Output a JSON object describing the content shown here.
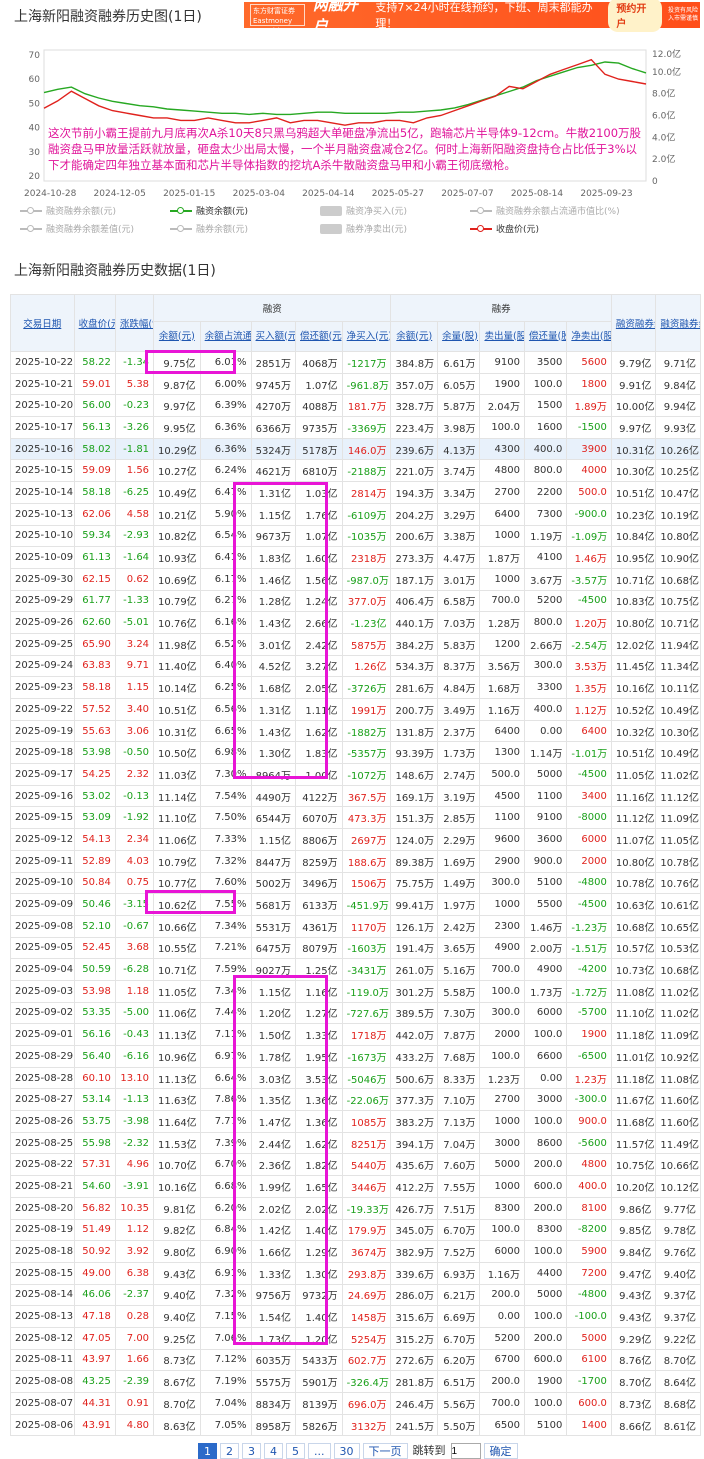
{
  "chart_section": {
    "title": "上海新阳融资融券历史图(1日)"
  },
  "ad": {
    "logo": "东方财富证券",
    "logo_sub": "Eastmoney Securities",
    "headline": "两融开户",
    "text": "支持7×24小时在线预约，下班、周末都能办理！",
    "button": "预约开户",
    "fine": "投资有风险 入市需谨慎"
  },
  "chart_annotation": "这次节前小霸王提前九月底再次A杀10天8只黑乌鸦超大单砸盘净流出5亿，跑输芯片半导体9-12cm。牛散2100万股融资盘马甲放量活跃就放量，砸盘太少出局太慢，一个半月融资盘减仓2亿。何时上海新阳融资盘持仓占比低于3%以下才能确定四年独立基本面和芯片半导体指数的挖坑A杀牛散融资盘马甲和小霸王彻底缴枪。",
  "chart_data": {
    "type": "line",
    "x_ticks": [
      "2024-10-28",
      "2024-12-05",
      "2025-01-15",
      "2025-03-04",
      "2025-04-14",
      "2025-05-27",
      "2025-07-07",
      "2025-08-14",
      "2025-09-23"
    ],
    "y_left_ticks": [
      "70",
      "60",
      "50",
      "40",
      "30",
      "20"
    ],
    "y_left_range": [
      18,
      72
    ],
    "y_right_ticks": [
      "12.0亿",
      "10.0亿",
      "8.0亿",
      "6.0亿",
      "4.0亿",
      "2.0亿",
      "0"
    ],
    "y_right_range": [
      0,
      12
    ],
    "series": [
      {
        "name": "融资余额(元)",
        "axis": "right",
        "color": "#27a822",
        "values": [
          8.1,
          8.4,
          8.6,
          8.0,
          7.6,
          7.3,
          7.1,
          6.9,
          6.8,
          6.6,
          6.5,
          6.4,
          6.3,
          6.2,
          6.2,
          6.1,
          6.2,
          6.1,
          6.1,
          6.2,
          6.3,
          6.3,
          6.2,
          6.2,
          6.2,
          6.2,
          6.3,
          6.3,
          6.4,
          6.5,
          6.7,
          7.0,
          7.4,
          7.8,
          8.2,
          8.6,
          9.2,
          9.6,
          10.0,
          10.4,
          10.6,
          10.9,
          10.8,
          10.3,
          9.9
        ]
      },
      {
        "name": "收盘价(元)",
        "axis": "left",
        "color": "#e0221d",
        "values": [
          48,
          51,
          55,
          52,
          49,
          47,
          46,
          45,
          44,
          44,
          43,
          43,
          44,
          43,
          42,
          42,
          43,
          44,
          42,
          43,
          43,
          42,
          41,
          42,
          42,
          43,
          43,
          42,
          44,
          45,
          47,
          49,
          51,
          53,
          57,
          56,
          59,
          62,
          64,
          66,
          68,
          62,
          60,
          59,
          58
        ]
      }
    ],
    "legend": [
      {
        "label": "融资融券余额(元)",
        "active": false,
        "kind": "line"
      },
      {
        "label": "融资余额(元)",
        "active": true,
        "kind": "line"
      },
      {
        "label": "融资净买入(元)",
        "active": false,
        "kind": "bar"
      },
      {
        "label": "融资融券余额占流通市值比(%)",
        "active": false,
        "kind": "line"
      },
      {
        "label": "融资融券余额差值(元)",
        "active": false,
        "kind": "line"
      },
      {
        "label": "融券余额(元)",
        "active": false,
        "kind": "line"
      },
      {
        "label": "融券净卖出(元)",
        "active": false,
        "kind": "bar"
      },
      {
        "label": "收盘价(元)",
        "active": true,
        "kind": "line"
      }
    ]
  },
  "table_section": {
    "title": "上海新阳融资融券历史数据(1日)"
  },
  "table": {
    "group_rz": "融资",
    "group_rq": "融券",
    "headers": {
      "date": "交易日期",
      "close": "收盘价(元)",
      "chg": "涨跌幅(%)",
      "rz_bal": "余额(元)",
      "rz_ratio": "余额占流通市值比",
      "rz_buy": "买入额(元)",
      "rz_repay": "偿还额(元)",
      "rz_net": "净买入(元)",
      "rq_bal": "余额(元)",
      "rq_vol": "余量(股)",
      "rq_sell": "卖出量(股)",
      "rq_repay": "偿还量(股)",
      "rq_net": "净卖出(股)",
      "total": "融资融券余额(元)",
      "diff": "融资融券余额差值(元)"
    },
    "rows": [
      [
        "2025-10-22",
        "58.22",
        "-1.34",
        "9.75亿",
        "6.01%",
        "2851万",
        "4068万",
        "-1217万",
        "384.8万",
        "6.61万",
        "9100",
        "3500",
        "5600",
        "9.79亿",
        "9.71亿"
      ],
      [
        "2025-10-21",
        "59.01",
        "5.38",
        "9.87亿",
        "6.00%",
        "9745万",
        "1.07亿",
        "-961.8万",
        "357.0万",
        "6.05万",
        "1900",
        "100.0",
        "1800",
        "9.91亿",
        "9.84亿"
      ],
      [
        "2025-10-20",
        "56.00",
        "-0.23",
        "9.97亿",
        "6.39%",
        "4270万",
        "4088万",
        "181.7万",
        "328.7万",
        "5.87万",
        "2.04万",
        "1500",
        "1.89万",
        "10.00亿",
        "9.94亿"
      ],
      [
        "2025-10-17",
        "56.13",
        "-3.26",
        "9.95亿",
        "6.36%",
        "6366万",
        "9735万",
        "-3369万",
        "223.4万",
        "3.98万",
        "100.0",
        "1600",
        "-1500",
        "9.97亿",
        "9.93亿"
      ],
      [
        "2025-10-16",
        "58.02",
        "-1.81",
        "10.29亿",
        "6.36%",
        "5324万",
        "5178万",
        "146.0万",
        "239.6万",
        "4.13万",
        "4300",
        "400.0",
        "3900",
        "10.31亿",
        "10.26亿"
      ],
      [
        "2025-10-15",
        "59.09",
        "1.56",
        "10.27亿",
        "6.24%",
        "4621万",
        "6810万",
        "-2188万",
        "221.0万",
        "3.74万",
        "4800",
        "800.0",
        "4000",
        "10.30亿",
        "10.25亿"
      ],
      [
        "2025-10-14",
        "58.18",
        "-6.25",
        "10.49亿",
        "6.47%",
        "1.31亿",
        "1.03亿",
        "2814万",
        "194.3万",
        "3.34万",
        "2700",
        "2200",
        "500.0",
        "10.51亿",
        "10.47亿"
      ],
      [
        "2025-10-13",
        "62.06",
        "4.58",
        "10.21亿",
        "5.90%",
        "1.15亿",
        "1.76亿",
        "-6109万",
        "204.2万",
        "3.29万",
        "6400",
        "7300",
        "-900.0",
        "10.23亿",
        "10.19亿"
      ],
      [
        "2025-10-10",
        "59.34",
        "-2.93",
        "10.82亿",
        "6.54%",
        "9673万",
        "1.07亿",
        "-1035万",
        "200.6万",
        "3.38万",
        "1000",
        "1.19万",
        "-1.09万",
        "10.84亿",
        "10.80亿"
      ],
      [
        "2025-10-09",
        "61.13",
        "-1.64",
        "10.93亿",
        "6.41%",
        "1.83亿",
        "1.60亿",
        "2318万",
        "273.3万",
        "4.47万",
        "1.87万",
        "4100",
        "1.46万",
        "10.95亿",
        "10.90亿"
      ],
      [
        "2025-09-30",
        "62.15",
        "0.62",
        "10.69亿",
        "6.17%",
        "1.46亿",
        "1.56亿",
        "-987.0万",
        "187.1万",
        "3.01万",
        "1000",
        "3.67万",
        "-3.57万",
        "10.71亿",
        "10.68亿"
      ],
      [
        "2025-09-29",
        "61.77",
        "-1.33",
        "10.79亿",
        "6.27%",
        "1.28亿",
        "1.24亿",
        "377.0万",
        "406.4万",
        "6.58万",
        "700.0",
        "5200",
        "-4500",
        "10.83亿",
        "10.75亿"
      ],
      [
        "2025-09-26",
        "62.60",
        "-5.01",
        "10.76亿",
        "6.16%",
        "1.43亿",
        "2.66亿",
        "-1.23亿",
        "440.1万",
        "7.03万",
        "1.28万",
        "800.0",
        "1.20万",
        "10.80亿",
        "10.71亿"
      ],
      [
        "2025-09-25",
        "65.90",
        "3.24",
        "11.98亿",
        "6.52%",
        "3.01亿",
        "2.42亿",
        "5875万",
        "384.2万",
        "5.83万",
        "1200",
        "2.66万",
        "-2.54万",
        "12.02亿",
        "11.94亿"
      ],
      [
        "2025-09-24",
        "63.83",
        "9.71",
        "11.40亿",
        "6.40%",
        "4.52亿",
        "3.27亿",
        "1.26亿",
        "534.3万",
        "8.37万",
        "3.56万",
        "300.0",
        "3.53万",
        "11.45亿",
        "11.34亿"
      ],
      [
        "2025-09-23",
        "58.18",
        "1.15",
        "10.14亿",
        "6.25%",
        "1.68亿",
        "2.05亿",
        "-3726万",
        "281.6万",
        "4.84万",
        "1.68万",
        "3300",
        "1.35万",
        "10.16亿",
        "10.11亿"
      ],
      [
        "2025-09-22",
        "57.52",
        "3.40",
        "10.51亿",
        "6.56%",
        "1.31亿",
        "1.11亿",
        "1991万",
        "200.7万",
        "3.49万",
        "1.16万",
        "400.0",
        "1.12万",
        "10.52亿",
        "10.49亿"
      ],
      [
        "2025-09-19",
        "55.63",
        "3.06",
        "10.31亿",
        "6.65%",
        "1.43亿",
        "1.62亿",
        "-1882万",
        "131.8万",
        "2.37万",
        "6400",
        "0.00",
        "6400",
        "10.32亿",
        "10.30亿"
      ],
      [
        "2025-09-18",
        "53.98",
        "-0.50",
        "10.50亿",
        "6.98%",
        "1.30亿",
        "1.83亿",
        "-5357万",
        "93.39万",
        "1.73万",
        "1300",
        "1.14万",
        "-1.01万",
        "10.51亿",
        "10.49亿"
      ],
      [
        "2025-09-17",
        "54.25",
        "2.32",
        "11.03亿",
        "7.30%",
        "8964万",
        "1.00亿",
        "-1072万",
        "148.6万",
        "2.74万",
        "500.0",
        "5000",
        "-4500",
        "11.05亿",
        "11.02亿"
      ],
      [
        "2025-09-16",
        "53.02",
        "-0.13",
        "11.14亿",
        "7.54%",
        "4490万",
        "4122万",
        "367.5万",
        "169.1万",
        "3.19万",
        "4500",
        "1100",
        "3400",
        "11.16亿",
        "11.12亿"
      ],
      [
        "2025-09-15",
        "53.09",
        "-1.92",
        "11.10亿",
        "7.50%",
        "6544万",
        "6070万",
        "473.3万",
        "151.3万",
        "2.85万",
        "1100",
        "9100",
        "-8000",
        "11.12亿",
        "11.09亿"
      ],
      [
        "2025-09-12",
        "54.13",
        "2.34",
        "11.06亿",
        "7.33%",
        "1.15亿",
        "8806万",
        "2697万",
        "124.0万",
        "2.29万",
        "9600",
        "3600",
        "6000",
        "11.07亿",
        "11.05亿"
      ],
      [
        "2025-09-11",
        "52.89",
        "4.03",
        "10.79亿",
        "7.32%",
        "8447万",
        "8259万",
        "188.6万",
        "89.38万",
        "1.69万",
        "2900",
        "900.0",
        "2000",
        "10.80亿",
        "10.78亿"
      ],
      [
        "2025-09-10",
        "50.84",
        "0.75",
        "10.77亿",
        "7.60%",
        "5002万",
        "3496万",
        "1506万",
        "75.75万",
        "1.49万",
        "300.0",
        "5100",
        "-4800",
        "10.78亿",
        "10.76亿"
      ],
      [
        "2025-09-09",
        "50.46",
        "-3.15",
        "10.62亿",
        "7.55%",
        "5681万",
        "6133万",
        "-451.9万",
        "99.41万",
        "1.97万",
        "1000",
        "5500",
        "-4500",
        "10.63亿",
        "10.61亿"
      ],
      [
        "2025-09-08",
        "52.10",
        "-0.67",
        "10.66亿",
        "7.34%",
        "5531万",
        "4361万",
        "1170万",
        "126.1万",
        "2.42万",
        "2300",
        "1.46万",
        "-1.23万",
        "10.68亿",
        "10.65亿"
      ],
      [
        "2025-09-05",
        "52.45",
        "3.68",
        "10.55亿",
        "7.21%",
        "6475万",
        "8079万",
        "-1603万",
        "191.4万",
        "3.65万",
        "4900",
        "2.00万",
        "-1.51万",
        "10.57亿",
        "10.53亿"
      ],
      [
        "2025-09-04",
        "50.59",
        "-6.28",
        "10.71亿",
        "7.59%",
        "9027万",
        "1.25亿",
        "-3431万",
        "261.0万",
        "5.16万",
        "700.0",
        "4900",
        "-4200",
        "10.73亿",
        "10.68亿"
      ],
      [
        "2025-09-03",
        "53.98",
        "1.18",
        "11.05亿",
        "7.34%",
        "1.15亿",
        "1.16亿",
        "-119.0万",
        "301.2万",
        "5.58万",
        "100.0",
        "1.73万",
        "-1.72万",
        "11.08亿",
        "11.02亿"
      ],
      [
        "2025-09-02",
        "53.35",
        "-5.00",
        "11.06亿",
        "7.44%",
        "1.20亿",
        "1.27亿",
        "-727.6万",
        "389.5万",
        "7.30万",
        "300.0",
        "6000",
        "-5700",
        "11.10亿",
        "11.02亿"
      ],
      [
        "2025-09-01",
        "56.16",
        "-0.43",
        "11.13亿",
        "7.11%",
        "1.50亿",
        "1.33亿",
        "1718万",
        "442.0万",
        "7.87万",
        "2000",
        "100.0",
        "1900",
        "11.18亿",
        "11.09亿"
      ],
      [
        "2025-08-29",
        "56.40",
        "-6.16",
        "10.96亿",
        "6.97%",
        "1.78亿",
        "1.95亿",
        "-1673万",
        "433.2万",
        "7.68万",
        "100.0",
        "6600",
        "-6500",
        "11.01亿",
        "10.92亿"
      ],
      [
        "2025-08-28",
        "60.10",
        "13.10",
        "11.13亿",
        "6.64%",
        "3.03亿",
        "3.53亿",
        "-5046万",
        "500.6万",
        "8.33万",
        "1.23万",
        "0.00",
        "1.23万",
        "11.18亿",
        "11.08亿"
      ],
      [
        "2025-08-27",
        "53.14",
        "-1.13",
        "11.63亿",
        "7.86%",
        "1.35亿",
        "1.36亿",
        "-22.06万",
        "377.3万",
        "7.10万",
        "2700",
        "3000",
        "-300.0",
        "11.67亿",
        "11.60亿"
      ],
      [
        "2025-08-26",
        "53.75",
        "-3.98",
        "11.64亿",
        "7.77%",
        "1.47亿",
        "1.36亿",
        "1085万",
        "383.2万",
        "7.13万",
        "1000",
        "100.0",
        "900.0",
        "11.68亿",
        "11.60亿"
      ],
      [
        "2025-08-25",
        "55.98",
        "-2.32",
        "11.53亿",
        "7.39%",
        "2.44亿",
        "1.62亿",
        "8251万",
        "394.1万",
        "7.04万",
        "3000",
        "8600",
        "-5600",
        "11.57亿",
        "11.49亿"
      ],
      [
        "2025-08-22",
        "57.31",
        "4.96",
        "10.70亿",
        "6.70%",
        "2.36亿",
        "1.82亿",
        "5440万",
        "435.6万",
        "7.60万",
        "5000",
        "200.0",
        "4800",
        "10.75亿",
        "10.66亿"
      ],
      [
        "2025-08-21",
        "54.60",
        "-3.91",
        "10.16亿",
        "6.68%",
        "1.99亿",
        "1.65亿",
        "3446万",
        "412.2万",
        "7.55万",
        "1000",
        "600.0",
        "400.0",
        "10.20亿",
        "10.12亿"
      ],
      [
        "2025-08-20",
        "56.82",
        "10.35",
        "9.81亿",
        "6.20%",
        "2.02亿",
        "2.02亿",
        "-19.33万",
        "426.7万",
        "7.51万",
        "8300",
        "200.0",
        "8100",
        "9.86亿",
        "9.77亿"
      ],
      [
        "2025-08-19",
        "51.49",
        "1.12",
        "9.82亿",
        "6.84%",
        "1.42亿",
        "1.40亿",
        "179.9万",
        "345.0万",
        "6.70万",
        "100.0",
        "8300",
        "-8200",
        "9.85亿",
        "9.78亿"
      ],
      [
        "2025-08-18",
        "50.92",
        "3.92",
        "9.80亿",
        "6.90%",
        "1.66亿",
        "1.29亿",
        "3674万",
        "382.9万",
        "7.52万",
        "6000",
        "100.0",
        "5900",
        "9.84亿",
        "9.76亿"
      ],
      [
        "2025-08-15",
        "49.00",
        "6.38",
        "9.43亿",
        "6.91%",
        "1.33亿",
        "1.30亿",
        "293.8万",
        "339.6万",
        "6.93万",
        "1.16万",
        "4400",
        "7200",
        "9.47亿",
        "9.40亿"
      ],
      [
        "2025-08-14",
        "46.06",
        "-2.37",
        "9.40亿",
        "7.32%",
        "9756万",
        "9732万",
        "24.69万",
        "286.0万",
        "6.21万",
        "200.0",
        "5000",
        "-4800",
        "9.43亿",
        "9.37亿"
      ],
      [
        "2025-08-13",
        "47.18",
        "0.28",
        "9.40亿",
        "7.15%",
        "1.54亿",
        "1.40亿",
        "1458万",
        "315.6万",
        "6.69万",
        "0.00",
        "100.0",
        "-100.0",
        "9.43亿",
        "9.37亿"
      ],
      [
        "2025-08-12",
        "47.05",
        "7.00",
        "9.25亿",
        "7.06%",
        "1.73亿",
        "1.20亿",
        "5254万",
        "315.2万",
        "6.70万",
        "5200",
        "200.0",
        "5000",
        "9.29亿",
        "9.22亿"
      ],
      [
        "2025-08-11",
        "43.97",
        "1.66",
        "8.73亿",
        "7.12%",
        "6035万",
        "5433万",
        "602.7万",
        "272.6万",
        "6.20万",
        "6700",
        "600.0",
        "6100",
        "8.76亿",
        "8.70亿"
      ],
      [
        "2025-08-08",
        "43.25",
        "-2.39",
        "8.67亿",
        "7.19%",
        "5575万",
        "5901万",
        "-326.4万",
        "281.8万",
        "6.51万",
        "200.0",
        "1900",
        "-1700",
        "8.70亿",
        "8.64亿"
      ],
      [
        "2025-08-07",
        "44.31",
        "0.91",
        "8.70亿",
        "7.04%",
        "8834万",
        "8139万",
        "696.0万",
        "246.4万",
        "5.56万",
        "700.0",
        "100.0",
        "600.0",
        "8.73亿",
        "8.68亿"
      ],
      [
        "2025-08-06",
        "43.91",
        "4.80",
        "8.63亿",
        "7.05%",
        "8958万",
        "5826万",
        "3132万",
        "241.5万",
        "5.50万",
        "6500",
        "5100",
        "1400",
        "8.66亿",
        "8.61亿"
      ]
    ]
  },
  "pager": {
    "pages": [
      "1",
      "2",
      "3",
      "4",
      "5",
      "...",
      "30"
    ],
    "next": "下一页",
    "jump_label": "跳转到",
    "jump_value": "1",
    "go": "确定"
  }
}
